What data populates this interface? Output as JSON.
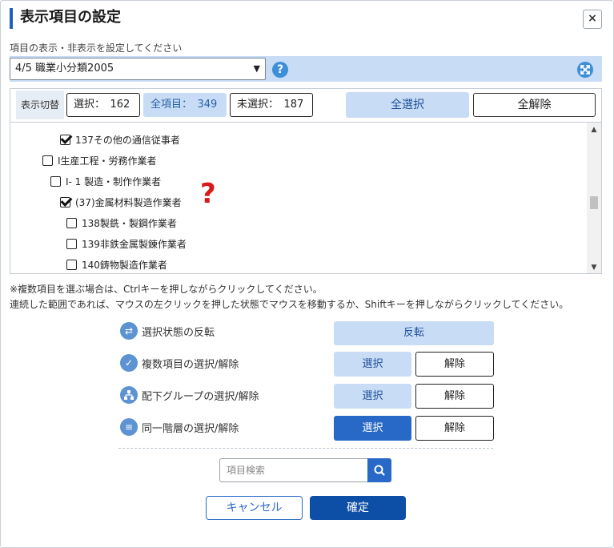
{
  "dialog": {
    "title": "表示項目の設定",
    "close_label": "×",
    "subtitle": "項目の表示・非表示を設定してください"
  },
  "selector": {
    "value": "4/5 職業小分類2005",
    "help_label": "?",
    "expand_icon": "expand-icon"
  },
  "toggle": {
    "label": "表示切替",
    "selected": "選択：　162",
    "all": "全項目：　349",
    "unselected": "未選択：　187",
    "select_all": "全選択",
    "clear_all": "全解除"
  },
  "tree": [
    {
      "label": "137その他の通信従事者",
      "checked": true
    },
    {
      "label": "I生産工程・労務作業者",
      "checked": false
    },
    {
      "label": "I- 1 製造・制作作業者",
      "checked": false
    },
    {
      "label": "(37)金属材料製造作業者",
      "checked": true
    },
    {
      "label": "138製銑・製鋼作業者",
      "checked": false
    },
    {
      "label": "139非鉄金属製錬作業者",
      "checked": false
    },
    {
      "label": "140鋳物製造作業者",
      "checked": false
    }
  ],
  "annotation": "?",
  "notes": {
    "line1": "※複数項目を選ぶ場合は、Ctrlキーを押しながらクリックしてください。",
    "line2": "連続した範囲であれば、マウスの左クリックを押した状態でマウスを移動するか、Shiftキーを押しながらクリックしてください。"
  },
  "operations": {
    "invert": {
      "label": "選択状態の反転",
      "button": "反転"
    },
    "multi": {
      "label": "複数項目の選択/解除",
      "select": "選択",
      "deselect": "解除"
    },
    "group": {
      "label": "配下グループの選択/解除",
      "select": "選択",
      "deselect": "解除"
    },
    "level": {
      "label": "同一階層の選択/解除",
      "select": "選択",
      "deselect": "解除"
    }
  },
  "search": {
    "placeholder": "項目検索"
  },
  "footer": {
    "cancel": "キャンセル",
    "confirm": "確定"
  },
  "colors": {
    "accent": "#2868c6",
    "light_blue": "#c8ddf5",
    "annotation_red": "#d91a1a"
  }
}
